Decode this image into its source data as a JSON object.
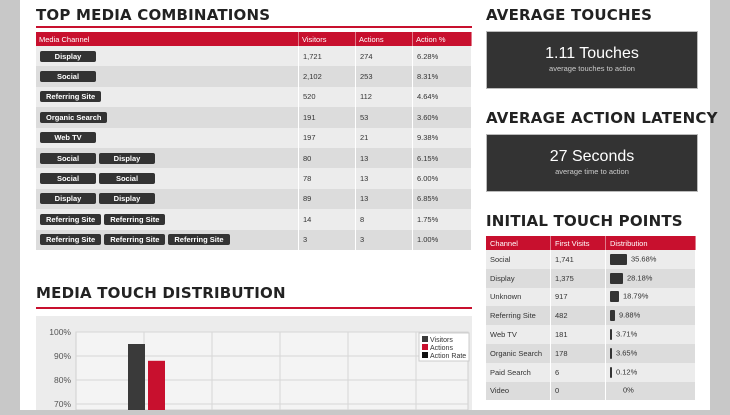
{
  "headers": {
    "combinations": "TOP MEDIA COMBINATIONS",
    "avg_touches": "AVERAGE TOUCHES",
    "avg_latency": "AVERAGE ACTION LATENCY",
    "initial_touch": "INITIAL TOUCH POINTS",
    "distribution": "MEDIA TOUCH DISTRIBUTION"
  },
  "combinations_table": {
    "columns": [
      "Media Channel",
      "Visitors",
      "Actions",
      "Action %"
    ],
    "rows": [
      {
        "channels": [
          "Display"
        ],
        "visitors": "1,721",
        "actions": "274",
        "rate": "6.28%"
      },
      {
        "channels": [
          "Social"
        ],
        "visitors": "2,102",
        "actions": "253",
        "rate": "8.31%"
      },
      {
        "channels": [
          "Referring Site"
        ],
        "visitors": "520",
        "actions": "112",
        "rate": "4.64%"
      },
      {
        "channels": [
          "Organic Search"
        ],
        "visitors": "191",
        "actions": "53",
        "rate": "3.60%"
      },
      {
        "channels": [
          "Web TV"
        ],
        "visitors": "197",
        "actions": "21",
        "rate": "9.38%"
      },
      {
        "channels": [
          "Social",
          "Display"
        ],
        "visitors": "80",
        "actions": "13",
        "rate": "6.15%"
      },
      {
        "channels": [
          "Social",
          "Social"
        ],
        "visitors": "78",
        "actions": "13",
        "rate": "6.00%"
      },
      {
        "channels": [
          "Display",
          "Display"
        ],
        "visitors": "89",
        "actions": "13",
        "rate": "6.85%"
      },
      {
        "channels": [
          "Referring Site",
          "Referring Site"
        ],
        "visitors": "14",
        "actions": "8",
        "rate": "1.75%"
      },
      {
        "channels": [
          "Referring Site",
          "Referring Site",
          "Referring Site"
        ],
        "visitors": "3",
        "actions": "3",
        "rate": "1.00%"
      }
    ]
  },
  "avg_touches": {
    "value": "1.11 Touches",
    "caption": "average touches to action"
  },
  "avg_latency": {
    "value": "27 Seconds",
    "caption": "average time to action"
  },
  "initial_touch_table": {
    "columns": [
      "Channel",
      "First Visits",
      "Distribution"
    ],
    "rows": [
      {
        "channel": "Social",
        "visits": "1,741",
        "pct": "35.68%",
        "share": 35.68
      },
      {
        "channel": "Display",
        "visits": "1,375",
        "pct": "28.18%",
        "share": 28.18
      },
      {
        "channel": "Unknown",
        "visits": "917",
        "pct": "18.79%",
        "share": 18.79
      },
      {
        "channel": "Referring Site",
        "visits": "482",
        "pct": "9.88%",
        "share": 9.88
      },
      {
        "channel": "Web TV",
        "visits": "181",
        "pct": "3.71%",
        "share": 3.71
      },
      {
        "channel": "Organic Search",
        "visits": "178",
        "pct": "3.65%",
        "share": 3.65
      },
      {
        "channel": "Paid Search",
        "visits": "6",
        "pct": "0.12%",
        "share": 0.12
      },
      {
        "channel": "Video",
        "visits": "0",
        "pct": "0%",
        "share": 0
      }
    ]
  },
  "chart_data": {
    "type": "bar",
    "title": "",
    "yticks": [
      "100%",
      "90%",
      "80%",
      "70%"
    ],
    "ylim": [
      65,
      100
    ],
    "legend_position": "top-right",
    "series": [
      {
        "name": "Visitors",
        "color": "#3a3a3a",
        "values": [
          95
        ]
      },
      {
        "name": "Actions",
        "color": "#c8102e",
        "values": [
          88
        ]
      },
      {
        "name": "Action Rate",
        "color": "#111111",
        "values": []
      }
    ]
  }
}
